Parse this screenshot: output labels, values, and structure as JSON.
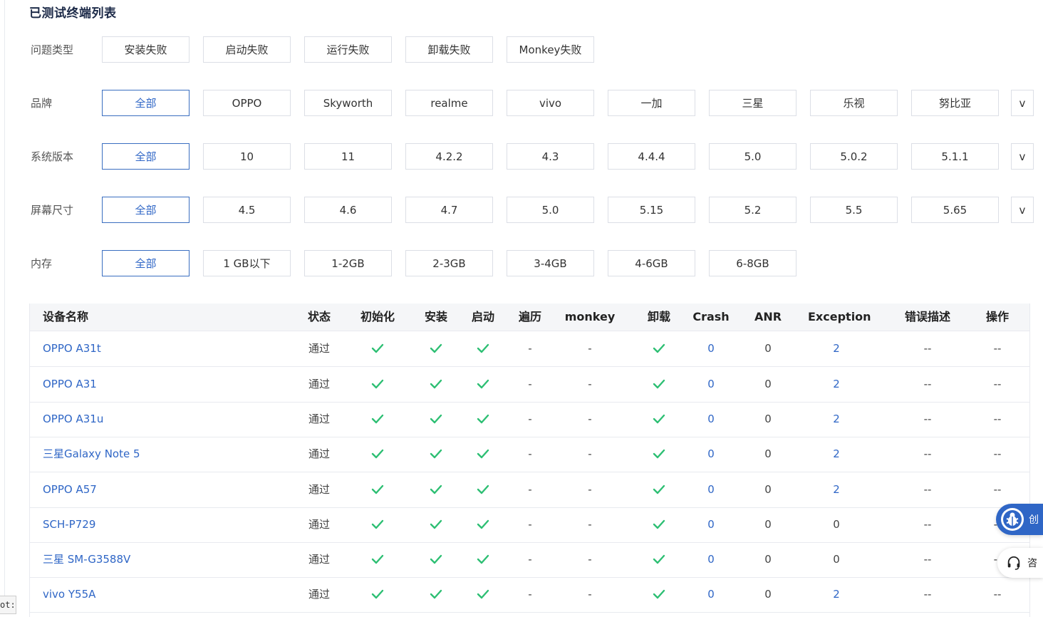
{
  "title": "已测试终端列表",
  "filters": [
    {
      "label": "问题类型",
      "options": [
        "安装失败",
        "启动失败",
        "运行失败",
        "卸载失败",
        "Monkey失败"
      ],
      "active": -1,
      "more": false
    },
    {
      "label": "品牌",
      "options": [
        "全部",
        "OPPO",
        "Skyworth",
        "realme",
        "vivo",
        "一加",
        "三星",
        "乐视",
        "努比亚"
      ],
      "active": 0,
      "more": true
    },
    {
      "label": "系统版本",
      "options": [
        "全部",
        "10",
        "11",
        "4.2.2",
        "4.3",
        "4.4.4",
        "5.0",
        "5.0.2",
        "5.1.1"
      ],
      "active": 0,
      "more": true
    },
    {
      "label": "屏幕尺寸",
      "options": [
        "全部",
        "4.5",
        "4.6",
        "4.7",
        "5.0",
        "5.15",
        "5.2",
        "5.5",
        "5.65"
      ],
      "active": 0,
      "more": true
    },
    {
      "label": "内存",
      "options": [
        "全部",
        "1 GB以下",
        "1-2GB",
        "2-3GB",
        "3-4GB",
        "4-6GB",
        "6-8GB"
      ],
      "active": 0,
      "more": false
    }
  ],
  "more_label": "v",
  "table": {
    "headers": [
      "设备名称",
      "状态",
      "初始化",
      "安装",
      "启动",
      "遍历",
      "monkey",
      "卸载",
      "Crash",
      "ANR",
      "Exception",
      "错误描述",
      "操作"
    ],
    "rows": [
      {
        "name": "OPPO A31t",
        "status": "通过",
        "init": true,
        "install": true,
        "launch": true,
        "traverse": "-",
        "monkey": "-",
        "uninstall": true,
        "crash": "0",
        "anr": "0",
        "exception": "2",
        "error": "--",
        "action": "--"
      },
      {
        "name": "OPPO A31",
        "status": "通过",
        "init": true,
        "install": true,
        "launch": true,
        "traverse": "-",
        "monkey": "-",
        "uninstall": true,
        "crash": "0",
        "anr": "0",
        "exception": "2",
        "error": "--",
        "action": "--"
      },
      {
        "name": "OPPO A31u",
        "status": "通过",
        "init": true,
        "install": true,
        "launch": true,
        "traverse": "-",
        "monkey": "-",
        "uninstall": true,
        "crash": "0",
        "anr": "0",
        "exception": "2",
        "error": "--",
        "action": "--"
      },
      {
        "name": "三星Galaxy Note 5",
        "status": "通过",
        "init": true,
        "install": true,
        "launch": true,
        "traverse": "-",
        "monkey": "-",
        "uninstall": true,
        "crash": "0",
        "anr": "0",
        "exception": "2",
        "error": "--",
        "action": "--"
      },
      {
        "name": "OPPO A57",
        "status": "通过",
        "init": true,
        "install": true,
        "launch": true,
        "traverse": "-",
        "monkey": "-",
        "uninstall": true,
        "crash": "0",
        "anr": "0",
        "exception": "2",
        "error": "--",
        "action": "--"
      },
      {
        "name": "SCH-P729",
        "status": "通过",
        "init": true,
        "install": true,
        "launch": true,
        "traverse": "-",
        "monkey": "-",
        "uninstall": true,
        "crash": "0",
        "anr": "0",
        "exception": "0",
        "error": "--",
        "action": "--"
      },
      {
        "name": "三星 SM-G3588V",
        "status": "通过",
        "init": true,
        "install": true,
        "launch": true,
        "traverse": "-",
        "monkey": "-",
        "uninstall": true,
        "crash": "0",
        "anr": "0",
        "exception": "0",
        "error": "--",
        "action": "--"
      },
      {
        "name": "vivo Y55A",
        "status": "通过",
        "init": true,
        "install": true,
        "launch": true,
        "traverse": "-",
        "monkey": "-",
        "uninstall": true,
        "crash": "0",
        "anr": "0",
        "exception": "2",
        "error": "--",
        "action": "--"
      }
    ]
  },
  "float_buttons": {
    "create": "创",
    "consult": "咨"
  },
  "status_tip": "ot:;",
  "colors": {
    "accent": "#2f66c6",
    "check": "#2dbf73",
    "border": "#dcdfe6"
  }
}
